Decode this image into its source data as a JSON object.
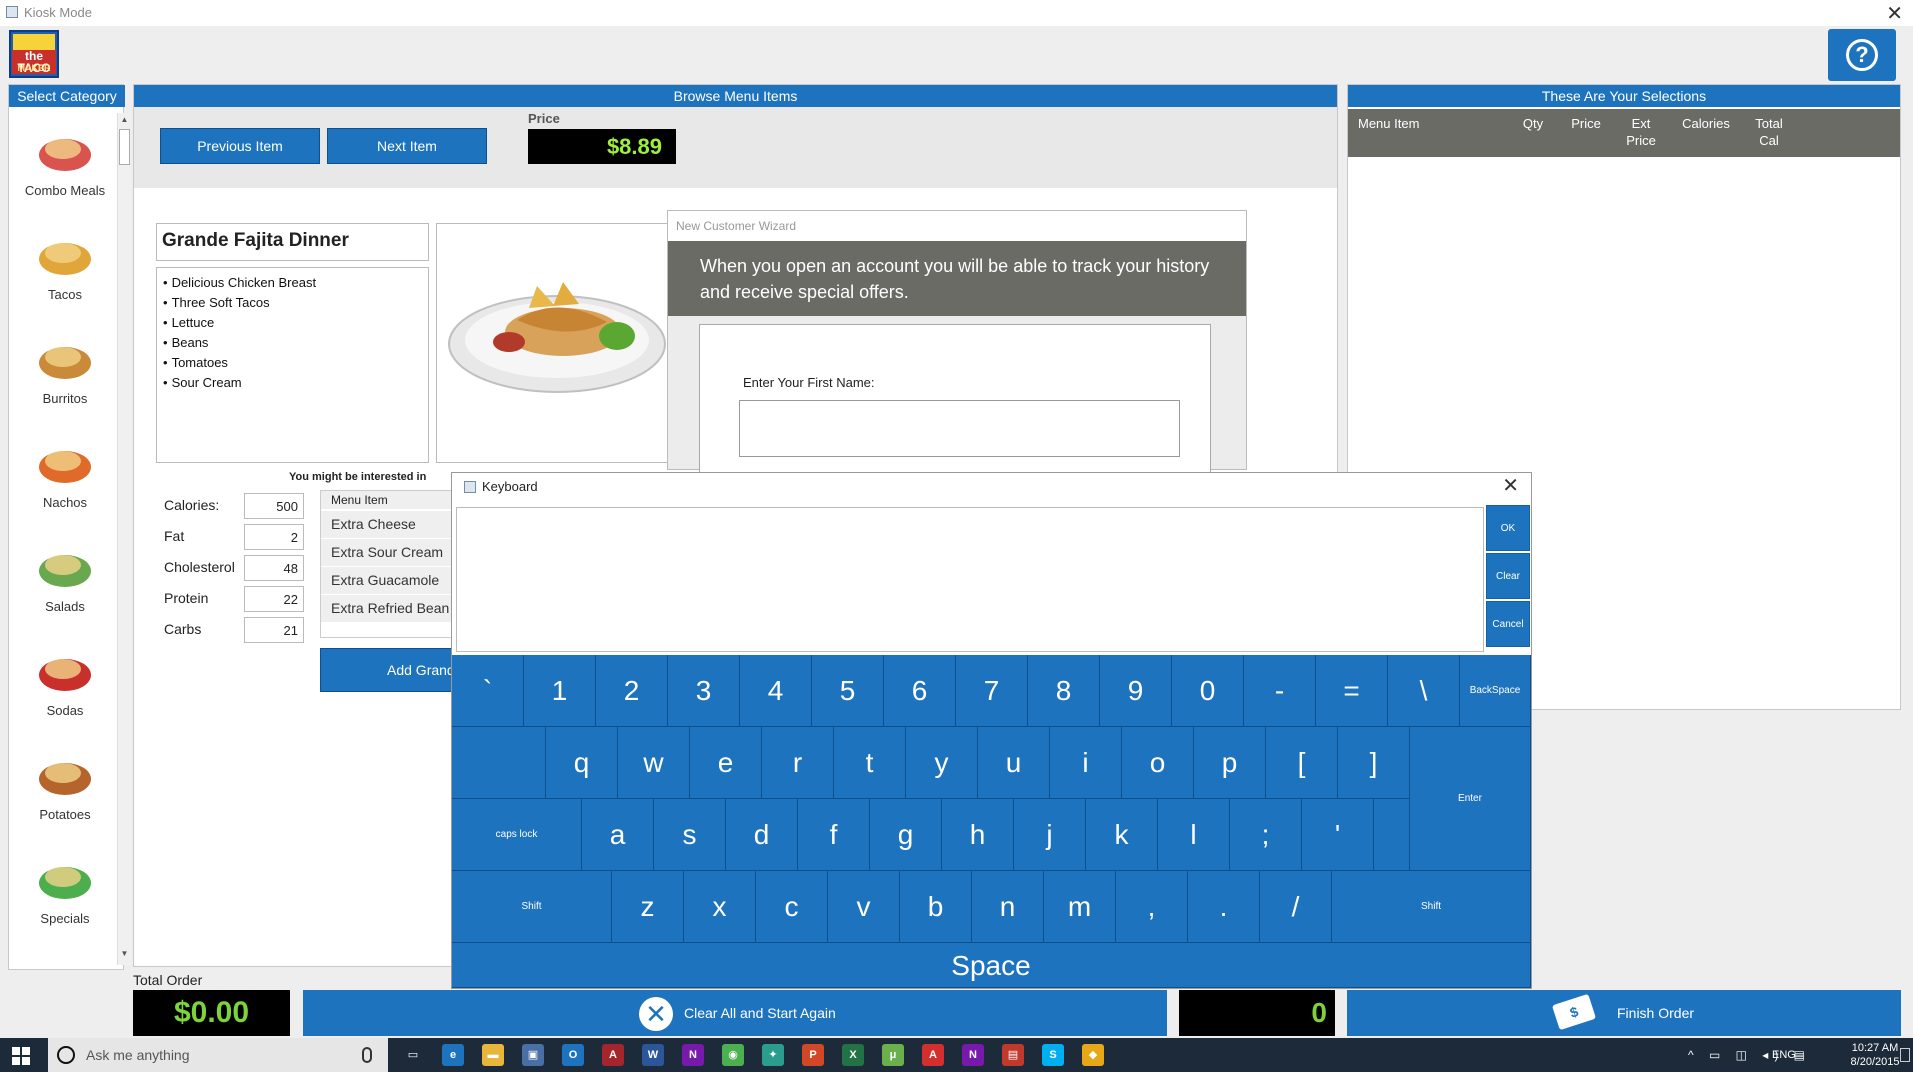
{
  "window": {
    "title": "Kiosk Mode"
  },
  "logo": {
    "line1": "the TACO",
    "line2": "MAKER"
  },
  "categories": {
    "header": "Select Category",
    "items": [
      {
        "label": "Combo Meals",
        "icon": "combo-meal-icon"
      },
      {
        "label": "Tacos",
        "icon": "taco-icon"
      },
      {
        "label": "Burritos",
        "icon": "burrito-icon"
      },
      {
        "label": "Nachos",
        "icon": "nachos-icon"
      },
      {
        "label": "Salads",
        "icon": "salad-icon"
      },
      {
        "label": "Sodas",
        "icon": "soda-icon"
      },
      {
        "label": "Potatoes",
        "icon": "potato-icon"
      },
      {
        "label": "Specials",
        "icon": "sale-tag-icon"
      }
    ]
  },
  "browse": {
    "header": "Browse Menu Items",
    "prev_label": "Previous Item",
    "next_label": "Next Item",
    "price_label": "Price",
    "price": "$8.89",
    "item_title": "Grande Fajita Dinner",
    "description": [
      "Delicious Chicken Breast",
      "Three Soft Tacos",
      "Lettuce",
      "Beans",
      "Tomatoes",
      "Sour Cream"
    ],
    "nutrition": [
      {
        "label": "Calories:",
        "value": "500"
      },
      {
        "label": "Fat",
        "value": "2"
      },
      {
        "label": "Cholesterol",
        "value": "48"
      },
      {
        "label": "Protein",
        "value": "22"
      },
      {
        "label": "Carbs",
        "value": "21"
      }
    ],
    "upsell_title": "You might be interested in",
    "upsell_col": "Menu Item",
    "upsell_items": [
      "Extra Cheese",
      "Extra Sour Cream",
      "Extra Guacamole",
      "Extra Refried Bean"
    ],
    "add_label": "Add Grand"
  },
  "selections": {
    "header": "These Are Your Selections",
    "columns": [
      {
        "line1": "Menu Item",
        "line2": ""
      },
      {
        "line1": "Qty",
        "line2": ""
      },
      {
        "line1": "Price",
        "line2": ""
      },
      {
        "line1": "Ext",
        "line2": "Price"
      },
      {
        "line1": "Calories",
        "line2": ""
      },
      {
        "line1": "Total",
        "line2": "Cal"
      }
    ]
  },
  "wizard": {
    "title": "New Customer Wizard",
    "message": "When you open an account you will be able to track your history and receive special offers.",
    "field_label": "Enter Your First Name:",
    "field_value": ""
  },
  "keyboard": {
    "title": "Keyboard",
    "ok": "OK",
    "clear": "Clear",
    "cancel": "Cancel",
    "row1": [
      "`",
      "1",
      "2",
      "3",
      "4",
      "5",
      "6",
      "7",
      "8",
      "9",
      "0",
      "-",
      "=",
      "\\"
    ],
    "backspace": "BackSpace",
    "row2": [
      "q",
      "w",
      "e",
      "r",
      "t",
      "y",
      "u",
      "i",
      "o",
      "p",
      "[",
      "]"
    ],
    "enter": "Enter",
    "caps": "caps lock",
    "row3": [
      "a",
      "s",
      "d",
      "f",
      "g",
      "h",
      "j",
      "k",
      "l",
      ";",
      "'"
    ],
    "shift": "Shift",
    "row4": [
      "z",
      "x",
      "c",
      "v",
      "b",
      "n",
      "m",
      ",",
      ".",
      "/"
    ],
    "space": "Space"
  },
  "footer": {
    "total_label": "Total Order",
    "total": "$0.00",
    "clear_all": "Clear All and Start Again",
    "count": "0",
    "finish": "Finish Order"
  },
  "taskbar": {
    "search_placeholder": "Ask me anything",
    "lang": "ENG",
    "time": "10:27 AM",
    "date": "8/20/2015"
  },
  "colors": {
    "accent": "#1e73be",
    "header_gray": "#6b6b65",
    "price_green": "#9ef03c"
  }
}
